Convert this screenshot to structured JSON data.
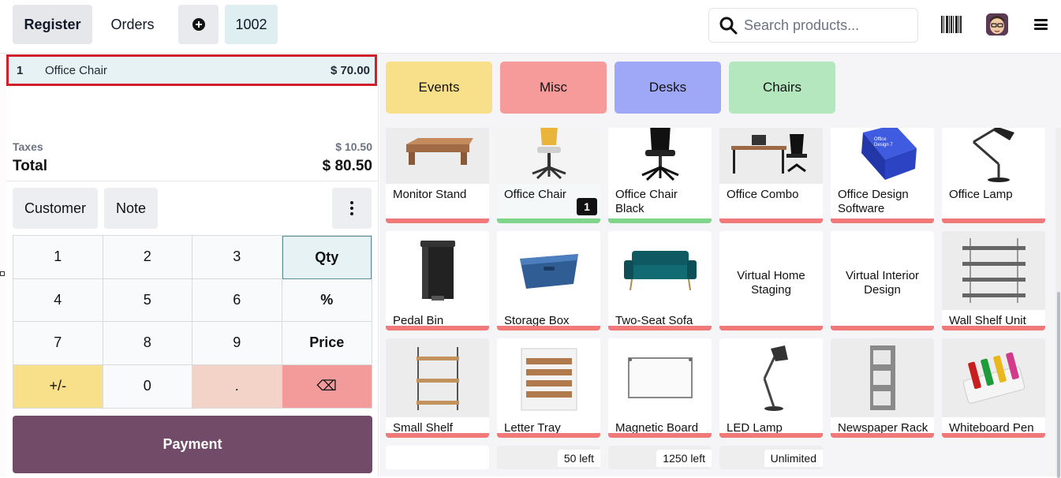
{
  "topbar": {
    "register_label": "Register",
    "orders_label": "Orders",
    "order_number": "1002",
    "search_placeholder": "Search products..."
  },
  "order": {
    "lines": [
      {
        "qty": "1",
        "name": "Office Chair",
        "price": "$ 70.00"
      }
    ],
    "taxes_label": "Taxes",
    "taxes_value": "$ 10.50",
    "total_label": "Total",
    "total_value": "$ 80.50"
  },
  "actions": {
    "customer_label": "Customer",
    "note_label": "Note"
  },
  "numpad": {
    "keys": [
      "1",
      "2",
      "3",
      "Qty",
      "4",
      "5",
      "6",
      "%",
      "7",
      "8",
      "9",
      "Price",
      "+/-",
      "0",
      ".",
      "⌫"
    ]
  },
  "payment_label": "Payment",
  "categories": [
    "Events",
    "Misc",
    "Desks",
    "Chairs"
  ],
  "products": [
    {
      "name": "Monitor Stand",
      "icon": "monitor-stand-image"
    },
    {
      "name": "Office Chair",
      "icon": "office-chair-image",
      "qty_badge": "1"
    },
    {
      "name": "Office Chair Black",
      "icon": "office-chair-black-image"
    },
    {
      "name": "Office Combo",
      "icon": "office-combo-image"
    },
    {
      "name": "Office Design Software",
      "icon": "software-box-image"
    },
    {
      "name": "Office Lamp",
      "icon": "desk-lamp-image"
    },
    {
      "name": "Pedal Bin",
      "icon": "pedal-bin-image"
    },
    {
      "name": "Storage Box",
      "icon": "storage-box-image"
    },
    {
      "name": "Two-Seat Sofa",
      "icon": "sofa-image"
    },
    {
      "name": "Virtual Home Staging"
    },
    {
      "name": "Virtual Interior Design"
    },
    {
      "name": "Wall Shelf Unit",
      "icon": "wall-shelf-image"
    },
    {
      "name": "Small Shelf",
      "icon": "small-shelf-image"
    },
    {
      "name": "Letter Tray",
      "icon": "letter-tray-image"
    },
    {
      "name": "Magnetic Board",
      "icon": "whiteboard-image"
    },
    {
      "name": "LED Lamp",
      "icon": "led-lamp-image"
    },
    {
      "name": "Newspaper Rack",
      "icon": "newspaper-rack-image"
    },
    {
      "name": "Whiteboard Pen",
      "icon": "markers-image"
    }
  ],
  "stock_badges": [
    "50 left",
    "1250 left",
    "Unlimited"
  ],
  "colors": {
    "accent": "#714b67",
    "selection_outline": "#d0202b",
    "out_of_stock_bar": "#f07a7a",
    "in_stock_bar": "#7fd58a"
  }
}
